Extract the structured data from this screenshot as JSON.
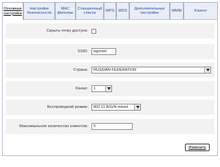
{
  "tabs": [
    {
      "label": "Основные\nнастройки",
      "active": true
    },
    {
      "label": "Настройки\nбезопасности",
      "active": false
    },
    {
      "label": "MAC\nфильтры",
      "active": false
    },
    {
      "label": "Станционный\nсписок",
      "active": false
    },
    {
      "label": "WPS",
      "active": false
    },
    {
      "label": "WDS",
      "active": false
    },
    {
      "label": "Дополнительные\nнастройки",
      "active": false
    },
    {
      "label": "WMM",
      "active": false
    },
    {
      "label": "Клиент",
      "active": false
    }
  ],
  "form": {
    "hide_ap": {
      "label": "Скрыть точку доступа:",
      "checked": false
    },
    "ssid": {
      "label": "SSID:",
      "value": "egornet"
    },
    "country": {
      "label": "Страна:",
      "value": "RUSSIAN FEDERATION"
    },
    "channel": {
      "label": "Канал:",
      "value": "1"
    },
    "wireless_mode": {
      "label": "Беспроводной режим:",
      "value": "802.11 B/G/N mixed"
    },
    "max_clients": {
      "label": "Максимальное количество клиентов:",
      "value": "5"
    }
  },
  "apply_button": "Изменить",
  "colors": {
    "tab_bg": "#e9edf6",
    "tab_text": "#1e4f98",
    "row_bg": "#f2f2f2",
    "border": "#b5bdcd"
  },
  "icons": {
    "dropdown": "chevron-down-icon"
  }
}
